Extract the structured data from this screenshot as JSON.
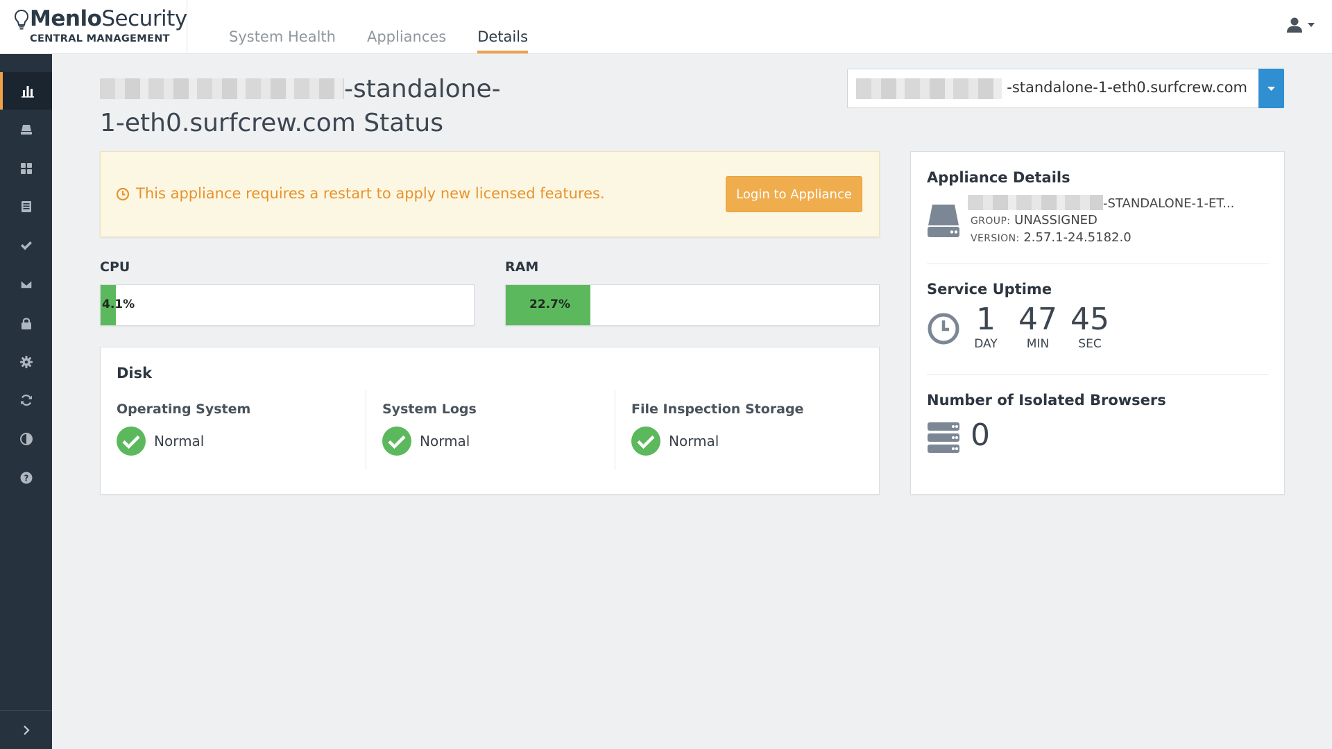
{
  "brand": {
    "name_bold": "Menlo",
    "name_regular": "Security",
    "subtitle": "CENTRAL MANAGEMENT"
  },
  "nav": {
    "tabs": [
      {
        "label": "System Health",
        "active": false
      },
      {
        "label": "Appliances",
        "active": false
      },
      {
        "label": "Details",
        "active": true
      }
    ]
  },
  "user_menu": {
    "icon": "user-icon",
    "caret": "caret-down-icon"
  },
  "sidebar": {
    "items": [
      {
        "icon": "bar-chart-icon",
        "active": true
      },
      {
        "icon": "appliance-icon",
        "active": false
      },
      {
        "icon": "dashboard-grid-icon",
        "active": false
      },
      {
        "icon": "list-icon",
        "active": false
      },
      {
        "icon": "check-icon",
        "active": false
      },
      {
        "icon": "envelope-icon",
        "active": false
      },
      {
        "icon": "lock-icon",
        "active": false
      },
      {
        "icon": "gear-icon",
        "active": false
      },
      {
        "icon": "refresh-icon",
        "active": false
      },
      {
        "icon": "contrast-icon",
        "active": false
      },
      {
        "icon": "help-icon",
        "active": false
      }
    ],
    "expand_icon": "chevron-right-icon"
  },
  "page": {
    "title_part1": "-standalone-",
    "title_part2": "1-eth0.surfcrew.com Status"
  },
  "appliance_selector": {
    "value_suffix": "-standalone-1-eth0.surfcrew.com"
  },
  "alert": {
    "icon": "clock-icon",
    "message": "This appliance requires a restart to apply new licensed features.",
    "button_label": "Login to Appliance",
    "color": "#e8922b"
  },
  "metrics": {
    "cpu": {
      "label": "CPU",
      "value_text": "4.1%",
      "percent": 4.1
    },
    "ram": {
      "label": "RAM",
      "value_text": "22.7%",
      "percent": 22.7
    },
    "fill_color": "#5cb85c"
  },
  "disk": {
    "title": "Disk",
    "items": [
      {
        "name": "Operating System",
        "status": "Normal"
      },
      {
        "name": "System Logs",
        "status": "Normal"
      },
      {
        "name": "File Inspection Storage",
        "status": "Normal"
      }
    ],
    "status_color": "#5cb85c"
  },
  "appliance_details": {
    "title": "Appliance Details",
    "icon": "hard-drive-icon",
    "name_suffix": "-STANDALONE-1-ET...",
    "group_label": "GROUP:",
    "group_value": "UNASSIGNED",
    "version_label": "VERSION:",
    "version_value": "2.57.1-24.5182.0"
  },
  "service_uptime": {
    "title": "Service Uptime",
    "icon": "clock-icon",
    "days": "1",
    "days_label": "DAY",
    "minutes": "47",
    "minutes_label": "MIN",
    "seconds": "45",
    "seconds_label": "SEC"
  },
  "isolated_browsers": {
    "title": "Number of Isolated Browsers",
    "icon": "server-stack-icon",
    "count": "0"
  },
  "colors": {
    "accent": "#f0a045",
    "sidebar_bg": "#26333f",
    "selector_button": "#2f8fd0"
  }
}
